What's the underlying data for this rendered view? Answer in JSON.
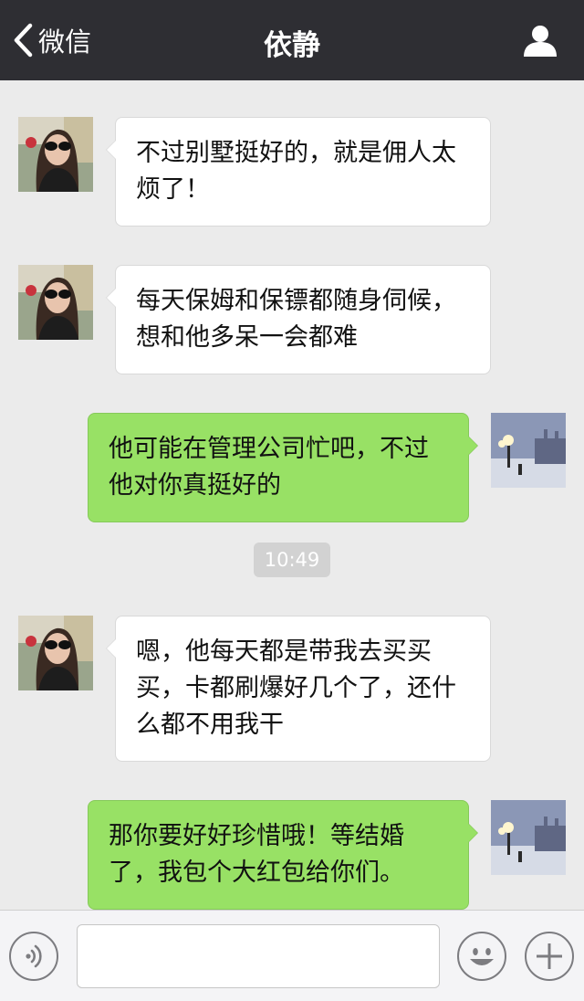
{
  "header": {
    "back_label": "微信",
    "title": "依静",
    "icons": {
      "back": "chevron-left-icon",
      "profile": "person-icon"
    }
  },
  "messages": [
    {
      "side": "left",
      "text": "不过别墅挺好的，就是佣人太烦了！"
    },
    {
      "side": "left",
      "text": "每天保姆和保镖都随身伺候，想和他多呆一会都难"
    },
    {
      "side": "right",
      "text": "他可能在管理公司忙吧，不过他对你真挺好的"
    },
    {
      "side": "left",
      "text": "嗯，他每天都是带我去买买买，卡都刷爆好几个了，还什么都不用我干"
    },
    {
      "side": "right",
      "text": "那你要好好珍惜哦！等结婚了，我包个大红包给你们。"
    }
  ],
  "timestamp": "10:49",
  "input_bar": {
    "text_value": "",
    "icons": {
      "voice": "voice-icon",
      "emoji": "emoji-icon",
      "more": "plus-icon"
    }
  },
  "colors": {
    "header_bg": "#2e2e33",
    "chat_bg": "#ebebeb",
    "sent_bubble": "#98e165",
    "received_bubble": "#ffffff"
  }
}
